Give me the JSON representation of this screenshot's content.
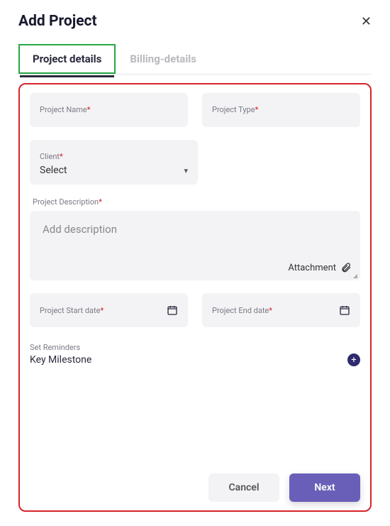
{
  "header": {
    "title": "Add Project",
    "close": "✕"
  },
  "tabs": {
    "details": "Project details",
    "billing": "Billing-details"
  },
  "fields": {
    "project_name": {
      "label": "Project Name"
    },
    "project_type": {
      "label": "Project Type"
    },
    "client": {
      "label": "Client",
      "value": "Select"
    },
    "description": {
      "label": "Project Description",
      "placeholder": "Add description",
      "attachment": "Attachment"
    },
    "start_date": {
      "label": "Project Start date"
    },
    "end_date": {
      "label": "Project End date"
    }
  },
  "reminders": {
    "label": "Set Reminders",
    "milestone": "Key Milestone"
  },
  "buttons": {
    "cancel": "Cancel",
    "next": "Next"
  }
}
